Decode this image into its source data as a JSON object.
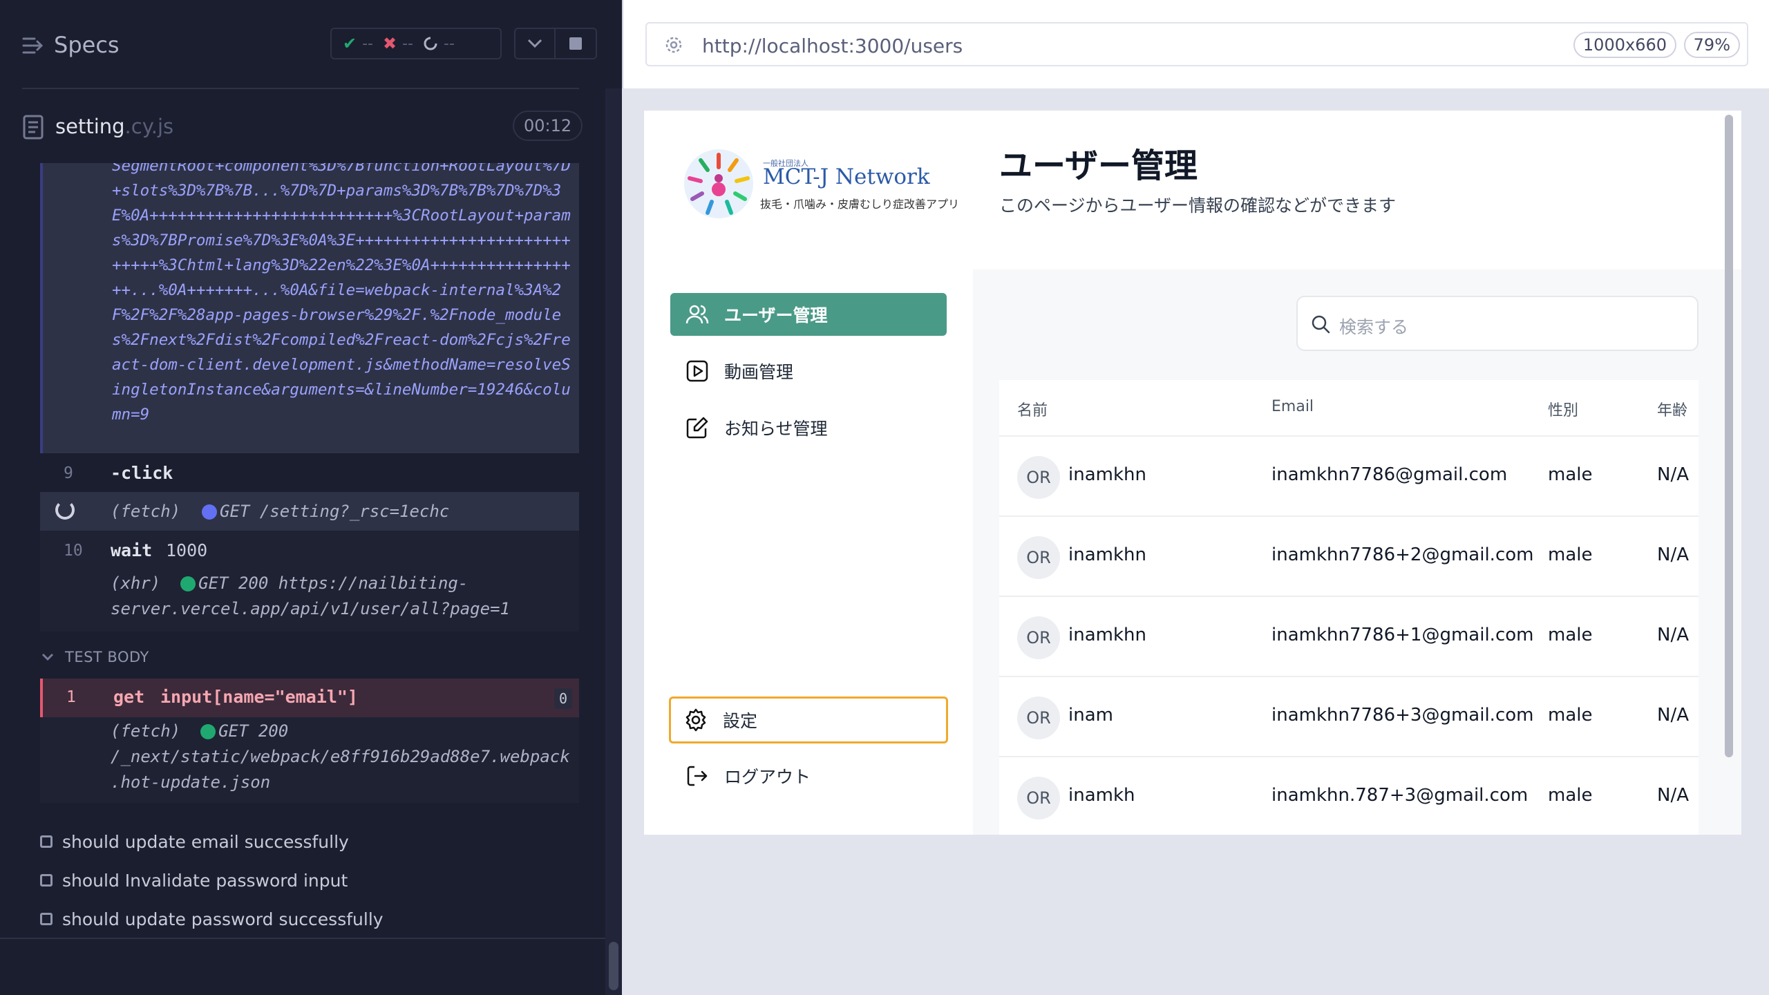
{
  "reporter": {
    "title": "Specs",
    "stats": {
      "passed": "--",
      "failed": "--",
      "pending": "--"
    },
    "file": {
      "name": "setting",
      "ext": ".cy.js",
      "timer": "00:12"
    },
    "url_text": "SegmentRoot+component%3D%7Bfunction+RootLayout%7D+slots%3D%7B%7B...%7D%7D+params%3D%7B%7B%7D%7D%3E%0A++++++++++++++++++++++++++%3CRootLayout+params%3D%7BPromise%7D%3E%0A%3E++++++++++++++++++++++++++++%3Chtml+lang%3D%22en%22%3E%0A+++++++++++++++++...%0A+++++++...%0A&file=webpack-internal%3A%2F%2F%2F%28app-pages-browser%29%2F.%2Fnode_modules%2Fnext%2Fdist%2Fcompiled%2Freact-dom%2Fcjs%2Freact-dom-client.development.js&methodName=resolveSingletonInstance&arguments=&lineNumber=19246&column=9",
    "commands": [
      {
        "line": "9",
        "name": "-click",
        "msg": ""
      },
      {
        "line": "",
        "name": "(fetch)",
        "msg": "GET /setting?_rsc=1echc"
      },
      {
        "line": "10",
        "name": "wait",
        "msg": "1000"
      }
    ],
    "xhr": {
      "name": "(xhr)",
      "line1": "GET 200 https://nailbiting-",
      "line2": "server.vercel.app/api/v1/user/all?page=1"
    },
    "section": "TEST BODY",
    "get_cmd": {
      "line": "1",
      "name": "get",
      "selector": "input[name=\"email\"]",
      "count": "0"
    },
    "fetch2": {
      "name": "(fetch)",
      "line1": "GET 200",
      "line2": "/_next/static/webpack/e8ff916b29ad88e7.webpack",
      "line3": ".hot-update.json"
    },
    "tests": [
      "should update email successfully",
      "should Invalidate password input",
      "should update password successfully"
    ]
  },
  "runner": {
    "url": "http://localhost:3000/users",
    "viewport": "1000x660",
    "zoom": "79%"
  },
  "app": {
    "logo": {
      "sub": "一般社団法人",
      "title": "MCT-J Network",
      "tagline": "抜毛・爪噛み・皮膚むしり症改善アプリ"
    },
    "nav": [
      {
        "label": "ユーザー管理",
        "icon": "users-icon"
      },
      {
        "label": "動画管理",
        "icon": "play-icon"
      },
      {
        "label": "お知らせ管理",
        "icon": "edit-icon"
      }
    ],
    "nav_bottom": [
      {
        "label": "設定",
        "icon": "gear-icon"
      },
      {
        "label": "ログアウト",
        "icon": "logout-icon"
      }
    ],
    "page_title": "ユーザー管理",
    "page_desc": "このページからユーザー情報の確認などができます",
    "search_placeholder": "検索する",
    "table": {
      "headers": [
        "名前",
        "Email",
        "性別",
        "年齢"
      ],
      "rows": [
        {
          "avatar": "OR",
          "name": "inamkhn",
          "email": "inamkhn7786@gmail.com",
          "gender": "male",
          "age": "N/A"
        },
        {
          "avatar": "OR",
          "name": "inamkhn",
          "email": "inamkhn7786+2@gmail.com",
          "gender": "male",
          "age": "N/A"
        },
        {
          "avatar": "OR",
          "name": "inamkhn",
          "email": "inamkhn7786+1@gmail.com",
          "gender": "male",
          "age": "N/A"
        },
        {
          "avatar": "OR",
          "name": "inam",
          "email": "inamkhn7786+3@gmail.com",
          "gender": "male",
          "age": "N/A"
        },
        {
          "avatar": "OR",
          "name": "inamkh",
          "email": "inamkhn.787+3@gmail.com",
          "gender": "male",
          "age": "N/A"
        }
      ]
    }
  },
  "colors": {
    "accent": "#4a9a88",
    "focus": "#f0a92b",
    "reporter_bg": "#1b1e2e",
    "fail": "#e45770",
    "pass": "#1fa971"
  }
}
